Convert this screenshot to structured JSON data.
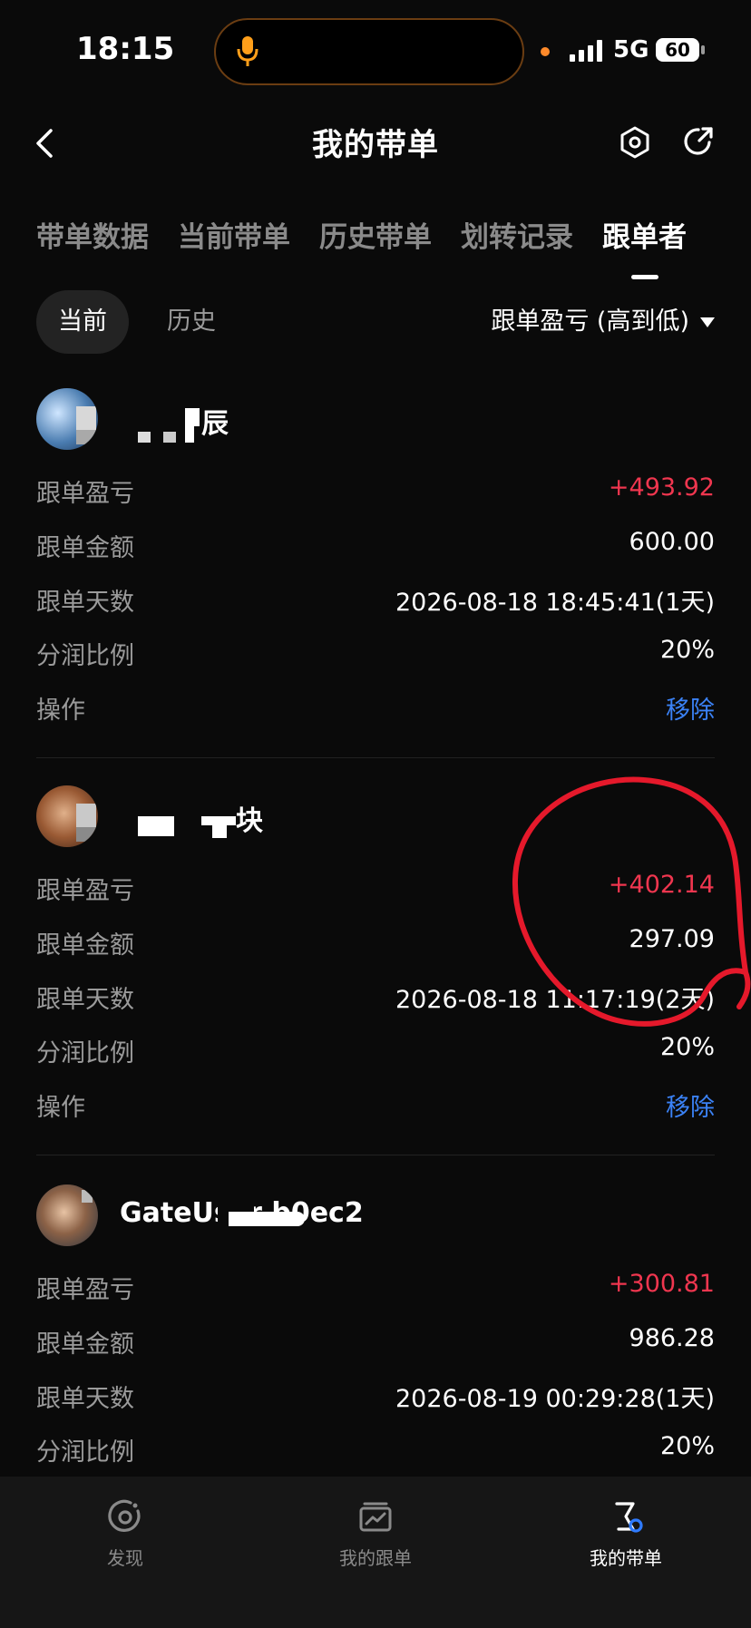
{
  "status_bar": {
    "time": "18:15",
    "network": "5G",
    "battery": "60"
  },
  "header": {
    "title": "我的带单"
  },
  "tabs": [
    {
      "label": "带单数据"
    },
    {
      "label": "当前带单"
    },
    {
      "label": "历史带单"
    },
    {
      "label": "划转记录"
    },
    {
      "label": "跟单者"
    }
  ],
  "filters": {
    "current": "当前",
    "history": "历史",
    "sort_label": "跟单盈亏 (高到低)"
  },
  "row_labels": {
    "pnl": "跟单盈亏",
    "amount": "跟单金额",
    "days": "跟单天数",
    "share": "分润比例",
    "action": "操作"
  },
  "followers": [
    {
      "name": "辰",
      "pnl": "+493.92",
      "amount": "600.00",
      "days": "2026-08-18 18:45:41(1天)",
      "share": "20%",
      "action": "移除"
    },
    {
      "name": "块",
      "pnl": "+402.14",
      "amount": "297.09",
      "days": "2026-08-18 11:17:19(2天)",
      "share": "20%",
      "action": "移除"
    },
    {
      "name": "GateUser b0ec2",
      "pnl": "+300.81",
      "amount": "986.28",
      "days": "2026-08-19 00:29:28(1天)",
      "share": "20%"
    }
  ],
  "bottom_nav": [
    {
      "label": "发现",
      "icon": "discover-icon"
    },
    {
      "label": "我的跟单",
      "icon": "chart-icon"
    },
    {
      "label": "我的带单",
      "icon": "lead-icon"
    }
  ],
  "colors": {
    "profit": "#f0364f",
    "action": "#3b82f6",
    "background": "#0a0a0a",
    "annotation": "#e5192b"
  }
}
